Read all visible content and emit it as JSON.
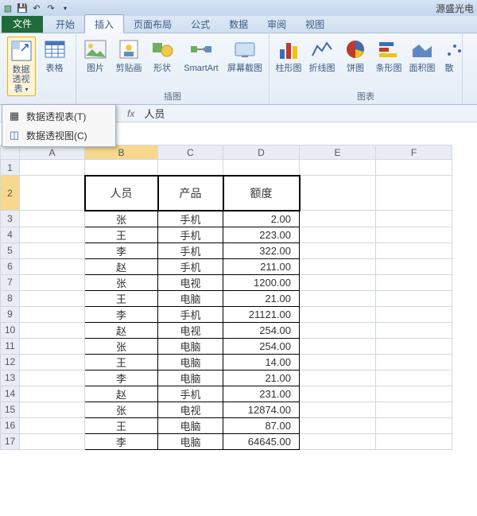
{
  "title_bar": {
    "app_title": "源盛光电"
  },
  "tabs": {
    "file": "文件",
    "items": [
      "开始",
      "插入",
      "页面布局",
      "公式",
      "数据",
      "审阅",
      "视图"
    ],
    "active_index": 1
  },
  "ribbon": {
    "pivot_group": {
      "pivot_btn": "数据\n透视表",
      "table_btn": "表格"
    },
    "illus_group": {
      "label": "插图",
      "pic": "图片",
      "clip": "剪贴画",
      "shape": "形状",
      "smart": "SmartArt",
      "screen": "屏幕截图"
    },
    "chart_group": {
      "label": "图表",
      "column": "柱形图",
      "line": "折线图",
      "pie": "饼图",
      "bar": "条形图",
      "area": "面积图",
      "scatter": "散"
    }
  },
  "pivot_menu": {
    "item1": "数据透视表(T)",
    "item2": "数据透视图(C)"
  },
  "formula_bar": {
    "fx": "fx",
    "value": "人员"
  },
  "columns": [
    "A",
    "B",
    "C",
    "D",
    "E",
    "F"
  ],
  "header_row": {
    "b": "人员",
    "c": "产品",
    "d": "额度"
  },
  "rows": [
    {
      "n": 3,
      "b": "张",
      "c": "手机",
      "d": "2.00"
    },
    {
      "n": 4,
      "b": "王",
      "c": "手机",
      "d": "223.00"
    },
    {
      "n": 5,
      "b": "李",
      "c": "手机",
      "d": "322.00"
    },
    {
      "n": 6,
      "b": "赵",
      "c": "手机",
      "d": "211.00"
    },
    {
      "n": 7,
      "b": "张",
      "c": "电视",
      "d": "1200.00"
    },
    {
      "n": 8,
      "b": "王",
      "c": "电脑",
      "d": "21.00"
    },
    {
      "n": 9,
      "b": "李",
      "c": "手机",
      "d": "21121.00"
    },
    {
      "n": 10,
      "b": "赵",
      "c": "电视",
      "d": "254.00"
    },
    {
      "n": 11,
      "b": "张",
      "c": "电脑",
      "d": "254.00"
    },
    {
      "n": 12,
      "b": "王",
      "c": "电脑",
      "d": "14.00"
    },
    {
      "n": 13,
      "b": "李",
      "c": "电脑",
      "d": "21.00"
    },
    {
      "n": 14,
      "b": "赵",
      "c": "手机",
      "d": "231.00"
    },
    {
      "n": 15,
      "b": "张",
      "c": "电视",
      "d": "12874.00"
    },
    {
      "n": 16,
      "b": "王",
      "c": "电脑",
      "d": "87.00"
    },
    {
      "n": 17,
      "b": "李",
      "c": "电脑",
      "d": "64645.00"
    }
  ],
  "chart_data": {
    "type": "table",
    "title": "",
    "columns": [
      "人员",
      "产品",
      "额度"
    ],
    "rows": [
      [
        "张",
        "手机",
        2.0
      ],
      [
        "王",
        "手机",
        223.0
      ],
      [
        "李",
        "手机",
        322.0
      ],
      [
        "赵",
        "手机",
        211.0
      ],
      [
        "张",
        "电视",
        1200.0
      ],
      [
        "王",
        "电脑",
        21.0
      ],
      [
        "李",
        "手机",
        21121.0
      ],
      [
        "赵",
        "电视",
        254.0
      ],
      [
        "张",
        "电脑",
        254.0
      ],
      [
        "王",
        "电脑",
        14.0
      ],
      [
        "李",
        "电脑",
        21.0
      ],
      [
        "赵",
        "手机",
        231.0
      ],
      [
        "张",
        "电视",
        12874.0
      ],
      [
        "王",
        "电脑",
        87.0
      ],
      [
        "李",
        "电脑",
        64645.0
      ]
    ]
  }
}
